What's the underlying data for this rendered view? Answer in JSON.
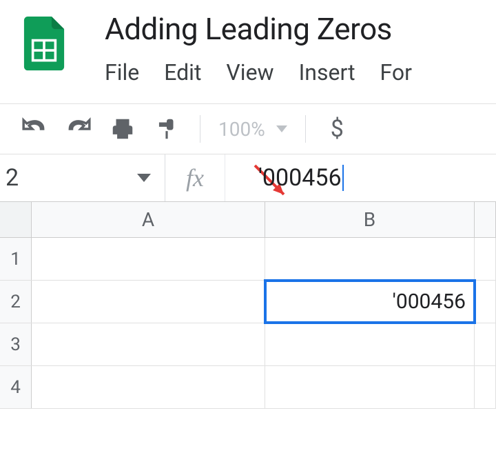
{
  "document": {
    "title": "Adding Leading Zeros"
  },
  "menu": {
    "file": "File",
    "edit": "Edit",
    "view": "View",
    "insert": "Insert",
    "format": "For"
  },
  "toolbar": {
    "zoom": "100%",
    "currency": "$"
  },
  "formula_bar": {
    "name_box": "2",
    "fx": "fx",
    "input": "'000456"
  },
  "columns": {
    "A": "A",
    "B": "B"
  },
  "rows": {
    "r1": "1",
    "r2": "2",
    "r3": "3",
    "r4": "4"
  },
  "cells": {
    "B2": "'000456"
  },
  "active_cell": "B2"
}
